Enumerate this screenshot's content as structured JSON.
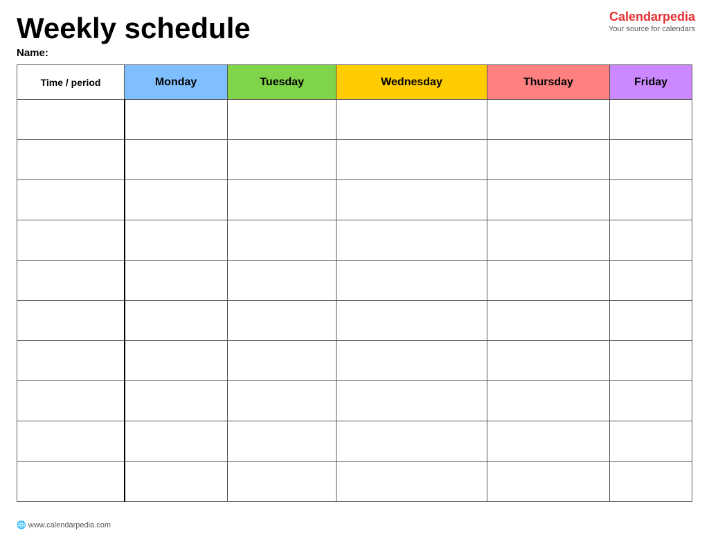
{
  "header": {
    "title": "Weekly schedule",
    "name_label": "Name:",
    "logo_brand": "Calendar",
    "logo_brand_accent": "pedia",
    "logo_subtitle": "Your source for calendars",
    "website": "www.calendarpedia.com"
  },
  "table": {
    "columns": [
      {
        "label": "Time / period",
        "class": "th-time"
      },
      {
        "label": "Monday",
        "class": "th-monday"
      },
      {
        "label": "Tuesday",
        "class": "th-tuesday"
      },
      {
        "label": "Wednesday",
        "class": "th-wednesday"
      },
      {
        "label": "Thursday",
        "class": "th-thursday"
      },
      {
        "label": "Friday",
        "class": "th-friday"
      }
    ],
    "row_count": 10
  },
  "colors": {
    "monday": "#80bfff",
    "tuesday": "#80d44a",
    "wednesday": "#ffcc00",
    "thursday": "#ff8080",
    "friday": "#cc88ff"
  }
}
